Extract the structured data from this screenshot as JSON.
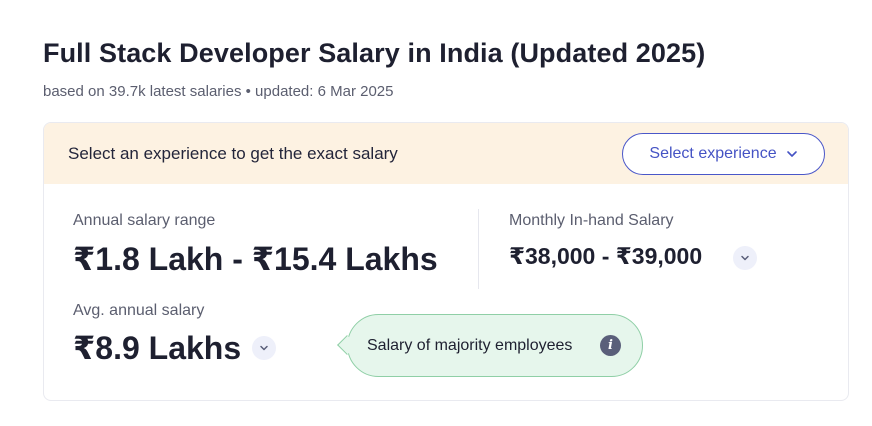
{
  "header": {
    "title": "Full Stack Developer Salary in India (Updated 2025)",
    "subtitle": "based on 39.7k latest salaries • updated: 6 Mar 2025"
  },
  "banner": {
    "text": "Select an experience to get the exact salary",
    "select_label": "Select experience"
  },
  "annual_range": {
    "label": "Annual salary range",
    "value": "₹1.8 Lakh - ₹15.4 Lakhs"
  },
  "monthly": {
    "label": "Monthly In-hand Salary",
    "value": "₹38,000 - ₹39,000"
  },
  "average": {
    "label": "Avg. annual salary",
    "value": "₹8.9 Lakhs"
  },
  "tooltip": {
    "text": "Salary of majority employees",
    "icon_glyph": "i"
  },
  "icons": {
    "chevron": "chevron-down-icon",
    "info": "info-icon"
  },
  "colors": {
    "accent": "#4553c4",
    "banner_bg": "#fdf2e2",
    "tooltip_bg": "#e6f6ec",
    "tooltip_border": "#8fcfa6"
  }
}
